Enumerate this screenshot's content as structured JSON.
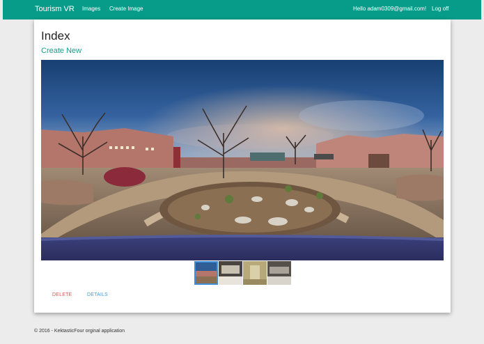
{
  "navbar": {
    "brand": "Tourism VR",
    "links": [
      "Images",
      "Create Image"
    ],
    "greeting": "Hello adam0309@gmail.com!",
    "logoff": "Log off"
  },
  "page": {
    "title": "Index",
    "create_link": "Create New"
  },
  "actions": {
    "delete": "DELETE",
    "details": "DETAILS"
  },
  "footer": {
    "text": "© 2016 - KektasticFour orginal application"
  },
  "thumbnails": {
    "count": 4,
    "selected_index": 0
  }
}
